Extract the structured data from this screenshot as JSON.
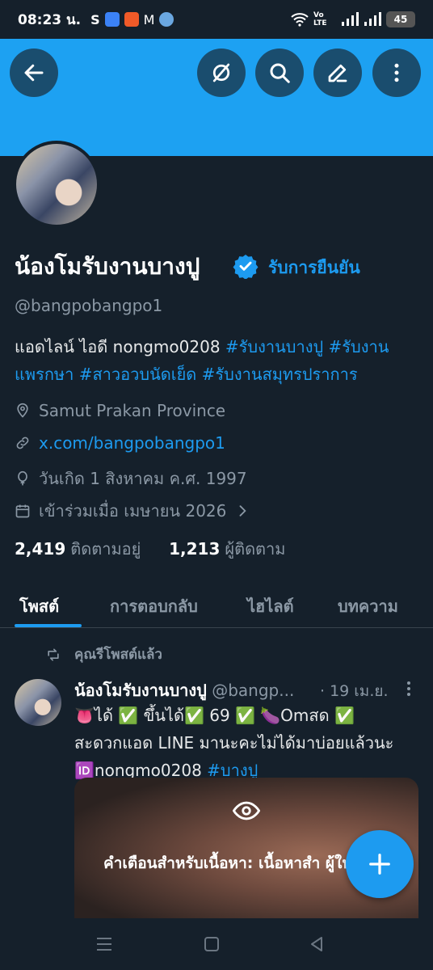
{
  "status_bar": {
    "time": "08:23 น.",
    "s_label": "S",
    "network_label": "Vo LTE",
    "battery": "45"
  },
  "header": {
    "back_icon": "arrow-left-icon",
    "actions": [
      "grok-icon",
      "search-icon",
      "edit-icon",
      "more-vertical-icon"
    ]
  },
  "profile": {
    "name": "น้องโมรับงานบางปู",
    "verify_label": "รับการยืนยัน",
    "handle": "@bangpobangpo1",
    "bio_text": "แอดไลน์ ไอดี nongmo0208 ",
    "bio_tags": [
      "#รับงานบางปู",
      "#รับงาน",
      "แพรกษา",
      "#สาวอวบนัดเย็ด",
      "#รับงานสมุทรปราการ"
    ],
    "location": "Samut Prakan Province",
    "website": "x.com/bangpobangpo1",
    "birthday": "วันเกิด 1 สิงหาคม ค.ศ. 1997",
    "joined": "เข้าร่วมเมื่อ เมษายน 2026",
    "following_count": "2,419",
    "following_label": "ติดตามอยู่",
    "followers_count": "1,213",
    "followers_label": "ผู้ติดตาม"
  },
  "tabs": [
    "โพสต์",
    "การตอบกลับ",
    "ไฮไลต์",
    "บทความ"
  ],
  "feed": {
    "repost_label": "คุณรีโพสต์แล้ว",
    "tweet": {
      "name": "น้องโมรับงานบางปู",
      "handle": "@bangp...",
      "date": "· 19 เม.ย.",
      "line1": "👅ได้ ✅ ขึ้นได้✅ 69 ✅ 🍆Omสด ✅",
      "line2": "สะดวกแอด LINE มานะคะไม่ได้มาบ่อยแล้วนะ",
      "line3_text": "🆔nongmo0208 ",
      "line3_tag": "#บางปู",
      "warning": "คำเตือนสำหรับเนื้อหา: เนื้อหาสำ ผู้ใหญ่"
    }
  },
  "colors": {
    "accent": "#1d9bf0",
    "banner": "#1da1f2",
    "background": "#15202b"
  }
}
